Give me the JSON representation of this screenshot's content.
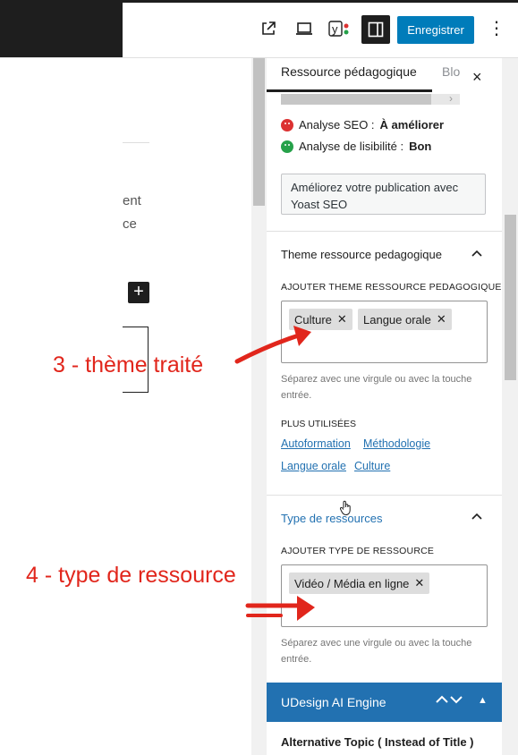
{
  "toolbar": {
    "save_label": "Enregistrer",
    "icons": [
      "external-link-icon",
      "laptop-icon",
      "yoast-icon",
      "sidebar-toggle-icon",
      "more-options-icon"
    ],
    "yoast_letter": "y"
  },
  "editor": {
    "fragment_1": "ent",
    "fragment_2": "ce",
    "insert_label": "+"
  },
  "annotations": {
    "annotation_3": "3 - thème traité",
    "annotation_4": "4 - type de ressource",
    "color": "#e1261c"
  },
  "sidebar": {
    "tab_active": "Ressource pédagogique",
    "tab_other": "Blo",
    "close": "×",
    "seo_label": "Analyse SEO :",
    "seo_value": "À améliorer",
    "readability_label": "Analyse de lisibilité :",
    "readability_value": "Bon",
    "yoast_cta_line1": "Améliorez votre publication avec",
    "yoast_cta_line2": "Yoast SEO"
  },
  "theme_panel": {
    "title": "Theme ressource pedagogique",
    "add_label": "AJOUTER THEME RESSOURCE PEDAGOGIQUE",
    "tokens": [
      "Culture",
      "Langue orale"
    ],
    "help_line1": "Séparez avec une virgule ou avec la touche",
    "help_line2": "entrée.",
    "most_used_label": "PLUS UTILISÉES",
    "most_used": [
      "Autoformation",
      "Méthodologie",
      "Langue orale",
      "Culture"
    ]
  },
  "type_panel": {
    "title": "Type de ressources",
    "add_label": "AJOUTER TYPE DE RESSOURCE",
    "tokens": [
      "Vidéo / Média en ligne"
    ],
    "help_line1": "Séparez avec une virgule ou avec la touche",
    "help_line2": "entrée."
  },
  "udesign": {
    "title": "UDesign AI Engine",
    "alt_topic": "Alternative Topic ( Instead of Title )"
  },
  "colors": {
    "accent": "#007cba",
    "panel_header": "#2271b1",
    "seo_bad": "#dc3232",
    "seo_good": "#26a14a",
    "link": "#2271b1"
  }
}
